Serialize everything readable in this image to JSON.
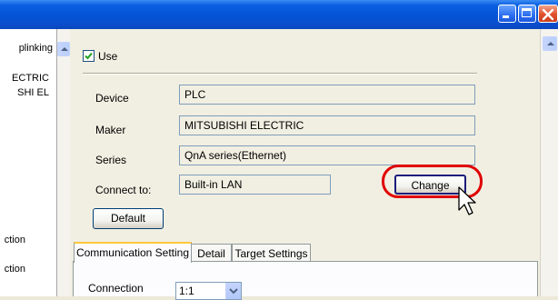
{
  "window": {
    "title_buttons": [
      "minimize-icon",
      "maximize-icon",
      "close-icon"
    ]
  },
  "left_panel": {
    "items": [
      "plinking",
      "ECTRIC",
      "SHI EL",
      "ction",
      "ction"
    ]
  },
  "use_checkbox": {
    "label": "Use",
    "checked": true
  },
  "form": {
    "device_label": "Device",
    "device_value": "PLC",
    "maker_label": "Maker",
    "maker_value": "MITSUBISHI ELECTRIC",
    "series_label": "Series",
    "series_value": "QnA series(Ethernet)",
    "connect_label": "Connect to:",
    "connect_value": "Built-in LAN",
    "change_button": "Change",
    "default_button": "Default"
  },
  "tabs": [
    {
      "label": "Communication Setting",
      "active": true
    },
    {
      "label": "Detail",
      "active": false
    },
    {
      "label": "Target Settings",
      "active": false
    }
  ],
  "communication": {
    "connection_label": "Connection",
    "connection_value": "1:1"
  },
  "colors": {
    "titlebar": "#0552d6",
    "highlight": "#e00000",
    "tab_active_accent": "#ffc73c"
  }
}
